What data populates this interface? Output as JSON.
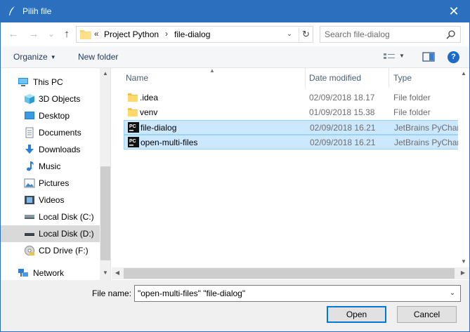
{
  "window": {
    "title": "Pilih file",
    "close_glyph": "✕",
    "title_icon": "quill-icon"
  },
  "nav": {
    "back_glyph": "←",
    "forward_glyph": "→",
    "recent_glyph": "⌄",
    "up_glyph": "↑",
    "breadcrumb": {
      "overflow": "«",
      "separator": "›",
      "items": [
        "Project Python",
        "file-dialog"
      ]
    },
    "dropdown_glyph": "⌄",
    "refresh_glyph": "↻",
    "search_placeholder": "Search file-dialog"
  },
  "toolbar": {
    "organize_label": "Organize",
    "organize_caret": "▼",
    "new_folder_label": "New folder",
    "view_caret": "▼",
    "help_glyph": "?"
  },
  "sidebar": {
    "items": [
      {
        "label": "This PC",
        "icon": "pc-icon",
        "level": 0
      },
      {
        "label": "3D Objects",
        "icon": "cube-icon",
        "level": 1
      },
      {
        "label": "Desktop",
        "icon": "desktop-icon",
        "level": 1
      },
      {
        "label": "Documents",
        "icon": "document-icon",
        "level": 1
      },
      {
        "label": "Downloads",
        "icon": "download-icon",
        "level": 1
      },
      {
        "label": "Music",
        "icon": "music-icon",
        "level": 1
      },
      {
        "label": "Pictures",
        "icon": "pictures-icon",
        "level": 1
      },
      {
        "label": "Videos",
        "icon": "video-icon",
        "level": 1
      },
      {
        "label": "Local Disk (C:)",
        "icon": "disk-icon",
        "level": 1
      },
      {
        "label": "Local Disk (D:)",
        "icon": "disk-icon",
        "level": 1,
        "selected": true
      },
      {
        "label": "CD Drive (F:)",
        "icon": "cd-icon",
        "level": 1
      },
      {
        "label": "Network",
        "icon": "network-icon",
        "level": 0
      }
    ]
  },
  "columns": {
    "name": "Name",
    "date": "Date modified",
    "type": "Type"
  },
  "files": [
    {
      "name": ".idea",
      "date": "02/09/2018 18.17",
      "type": "File folder",
      "icon": "folder-icon",
      "selected": false
    },
    {
      "name": "venv",
      "date": "01/09/2018 15.38",
      "type": "File folder",
      "icon": "folder-icon",
      "selected": false
    },
    {
      "name": "file-dialog",
      "date": "02/09/2018 16.21",
      "type": "JetBrains PyCharm",
      "icon": "pycharm-icon",
      "selected": true
    },
    {
      "name": "open-multi-files",
      "date": "02/09/2018 16.21",
      "type": "JetBrains PyCharm",
      "icon": "pycharm-icon",
      "selected": true
    }
  ],
  "footer": {
    "file_name_label": "File name:",
    "file_name_value": "\"open-multi-files\" \"file-dialog\"",
    "dropdown_glyph": "⌄",
    "open_label": "Open",
    "cancel_label": "Cancel"
  },
  "colors": {
    "titlebar": "#2b6fbf",
    "selection": "#cce8ff",
    "accent": "#0078d7"
  }
}
